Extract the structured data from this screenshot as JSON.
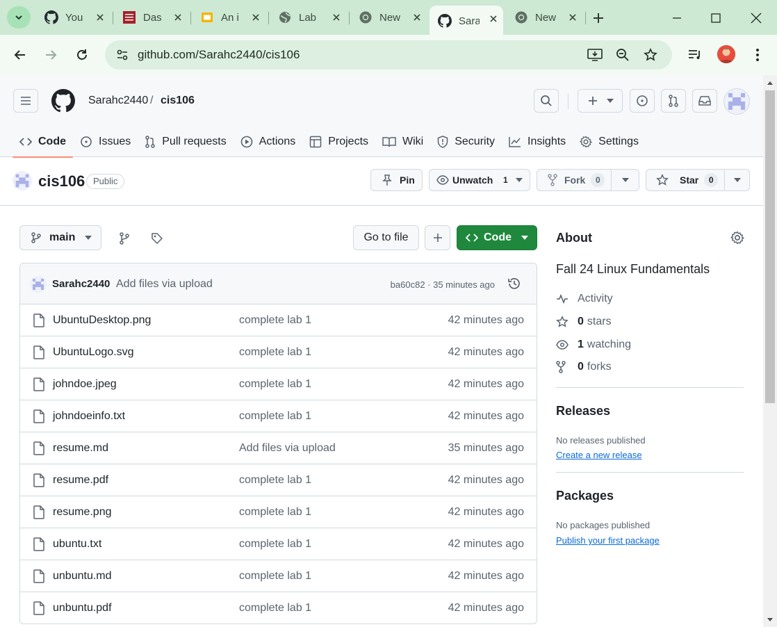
{
  "browser": {
    "tabs": [
      {
        "title": "You",
        "icon": "github-icon"
      },
      {
        "title": "Das",
        "icon": "college-logo-icon"
      },
      {
        "title": "An i",
        "icon": "slides-icon"
      },
      {
        "title": "Lab",
        "icon": "globe-icon"
      },
      {
        "title": "New",
        "icon": "chrome-icon"
      },
      {
        "title": "Sara",
        "icon": "github-icon",
        "active": true
      },
      {
        "title": "New",
        "icon": "chrome-icon"
      }
    ],
    "url": "github.com/Sarahc2440/cis106"
  },
  "header": {
    "owner": "Sarahc2440",
    "separator": "/",
    "repo": "cis106"
  },
  "nav": {
    "items": [
      {
        "label": "Code",
        "icon": "code-icon"
      },
      {
        "label": "Issues",
        "icon": "issue-icon"
      },
      {
        "label": "Pull requests",
        "icon": "pull-request-icon"
      },
      {
        "label": "Actions",
        "icon": "play-icon"
      },
      {
        "label": "Projects",
        "icon": "table-icon"
      },
      {
        "label": "Wiki",
        "icon": "book-icon"
      },
      {
        "label": "Security",
        "icon": "shield-icon"
      },
      {
        "label": "Insights",
        "icon": "graph-icon"
      },
      {
        "label": "Settings",
        "icon": "gear-icon"
      }
    ]
  },
  "repo": {
    "name": "cis106",
    "visibility": "Public",
    "pin_label": "Pin",
    "watch_label": "Unwatch",
    "watch_count": "1",
    "fork_label": "Fork",
    "fork_count": "0",
    "star_label": "Star",
    "star_count": "0"
  },
  "files_toolbar": {
    "branch": "main",
    "goto_label": "Go to file",
    "code_label": "Code"
  },
  "commit": {
    "user": "Sarahc2440",
    "message": "Add files via upload",
    "meta": "ba60c82 · 35 minutes ago"
  },
  "files": [
    {
      "name": "UbuntuDesktop.png",
      "message": "complete lab 1",
      "time": "42 minutes ago"
    },
    {
      "name": "UbuntuLogo.svg",
      "message": "complete lab 1",
      "time": "42 minutes ago"
    },
    {
      "name": "johndoe.jpeg",
      "message": "complete lab 1",
      "time": "42 minutes ago"
    },
    {
      "name": "johndoeinfo.txt",
      "message": "complete lab 1",
      "time": "42 minutes ago"
    },
    {
      "name": "resume.md",
      "message": "Add files via upload",
      "time": "35 minutes ago"
    },
    {
      "name": "resume.pdf",
      "message": "complete lab 1",
      "time": "42 minutes ago"
    },
    {
      "name": "resume.png",
      "message": "complete lab 1",
      "time": "42 minutes ago"
    },
    {
      "name": "ubuntu.txt",
      "message": "complete lab 1",
      "time": "42 minutes ago"
    },
    {
      "name": "unbuntu.md",
      "message": "complete lab 1",
      "time": "42 minutes ago"
    },
    {
      "name": "unbuntu.pdf",
      "message": "complete lab 1",
      "time": "42 minutes ago"
    }
  ],
  "about": {
    "title": "About",
    "description": "Fall 24 Linux Fundamentals",
    "activity": "Activity",
    "stars_count": "0",
    "stars_label": "stars",
    "watching_count": "1",
    "watching_label": "watching",
    "forks_count": "0",
    "forks_label": "forks"
  },
  "releases": {
    "title": "Releases",
    "empty": "No releases published",
    "link": "Create a new release"
  },
  "packages": {
    "title": "Packages",
    "empty": "No packages published",
    "link": "Publish your first package"
  },
  "colors": {
    "accent_green": "#1f883d",
    "link_blue": "#0969da",
    "tab_underline": "#fd8c73",
    "browser_frame": "#cde8d3"
  }
}
